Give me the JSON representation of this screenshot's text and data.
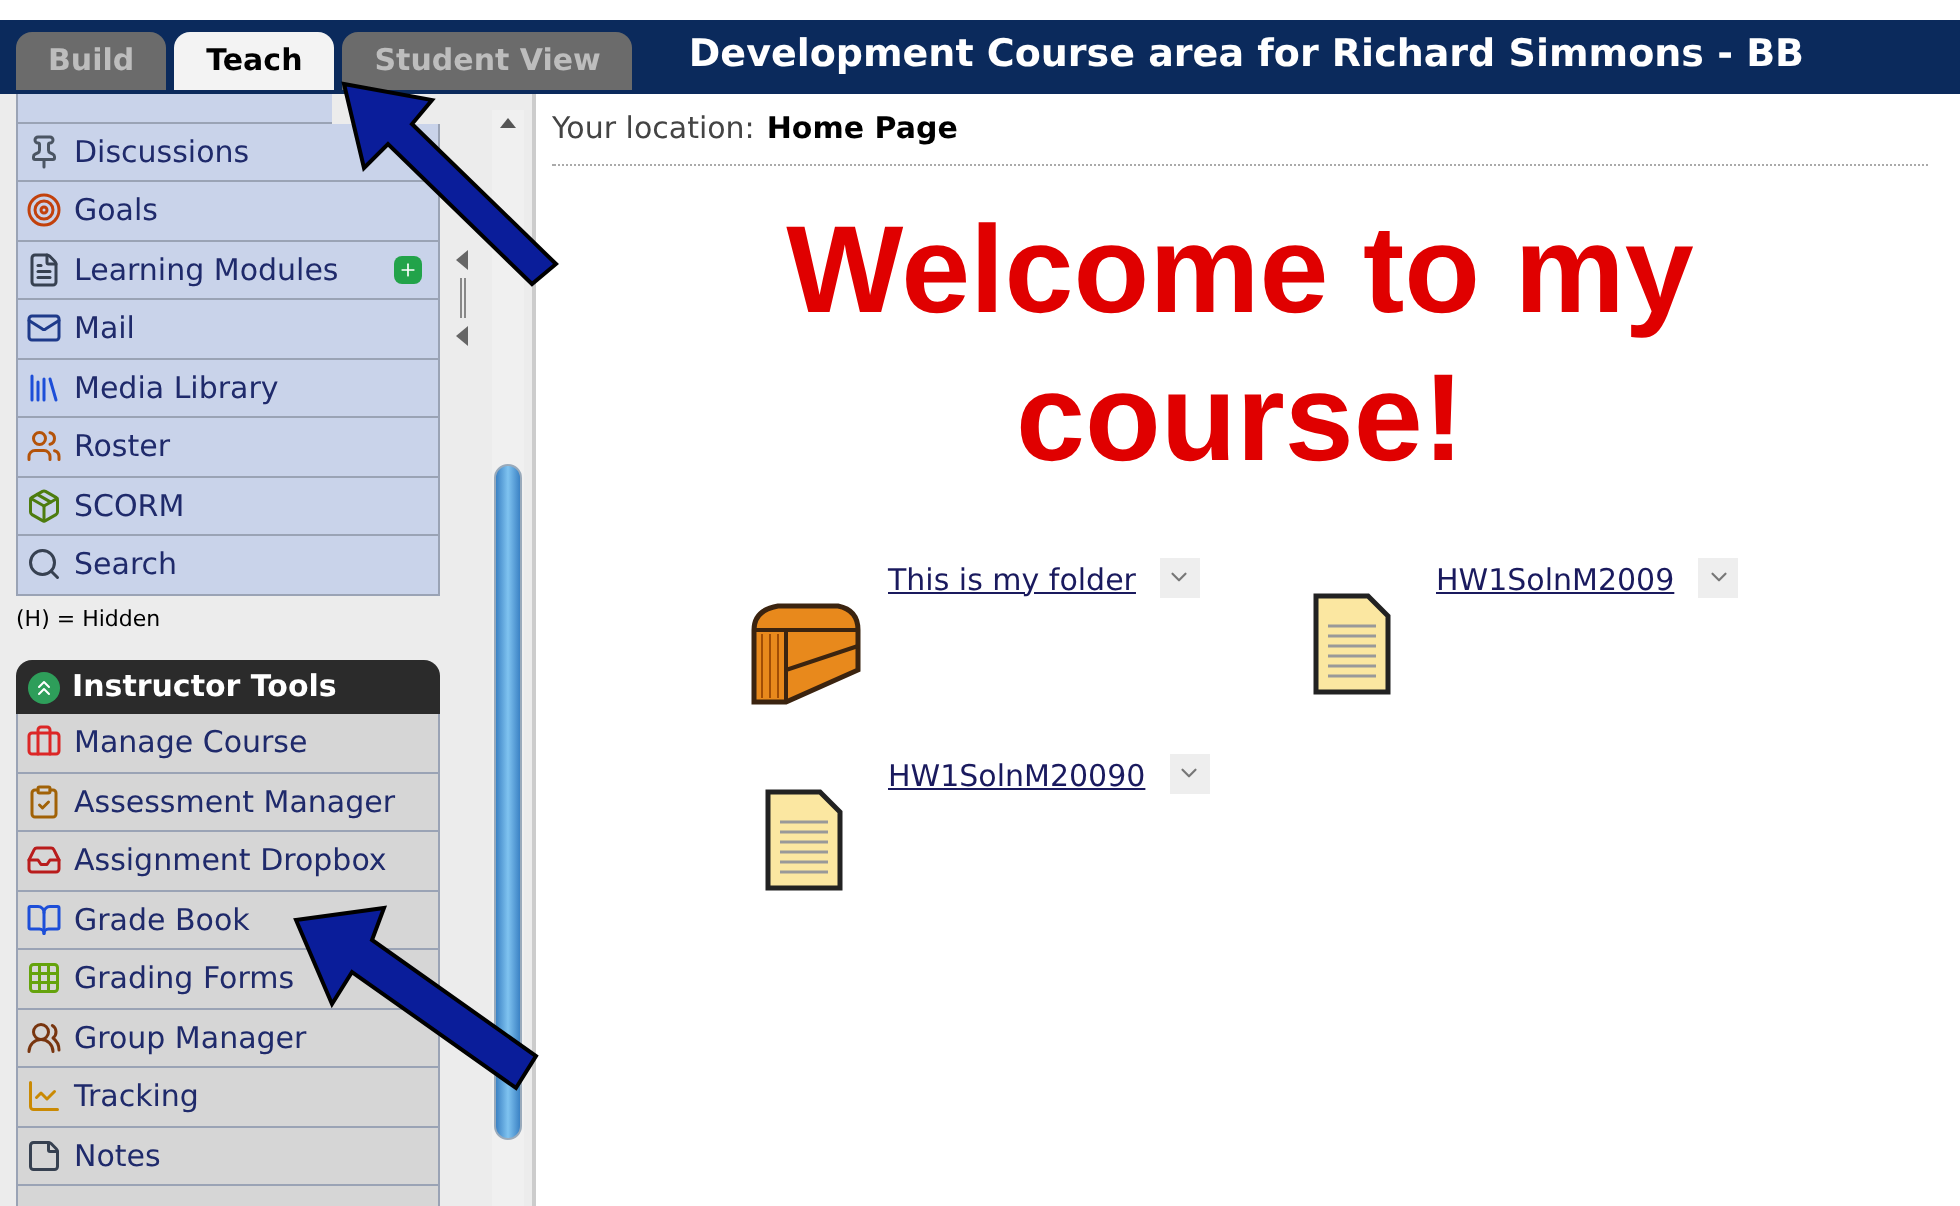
{
  "tabs": [
    {
      "label": "Build",
      "selected": false
    },
    {
      "label": "Teach",
      "selected": true
    },
    {
      "label": "Student View",
      "selected": false
    }
  ],
  "course_title": "Development Course area for Richard Simmons - BB",
  "sidebar": {
    "items": [
      {
        "label": "Discussions",
        "flagged": false
      },
      {
        "label": "Goals",
        "flagged": false
      },
      {
        "label": "Learning Modules",
        "flagged": true
      },
      {
        "label": "Mail",
        "flagged": false
      },
      {
        "label": "Media Library",
        "flagged": false
      },
      {
        "label": "Roster",
        "flagged": false
      },
      {
        "label": "SCORM",
        "flagged": false
      },
      {
        "label": "Search",
        "flagged": false
      }
    ],
    "legend": "(H) = Hidden",
    "instructor_tools": {
      "title": "Instructor Tools",
      "expanded": true,
      "items": [
        {
          "label": "Manage Course"
        },
        {
          "label": "Assessment Manager"
        },
        {
          "label": "Assignment Dropbox"
        },
        {
          "label": "Grade Book"
        },
        {
          "label": "Grading Forms"
        },
        {
          "label": "Group Manager"
        },
        {
          "label": "Tracking"
        },
        {
          "label": "Notes"
        }
      ]
    }
  },
  "breadcrumb": {
    "label": "Your location:",
    "value": "Home Page"
  },
  "heading": "Welcome to my course!",
  "content_items": [
    {
      "kind": "folder",
      "label": "This is my folder"
    },
    {
      "kind": "file",
      "label": "HW1SolnM2009"
    },
    {
      "kind": "file",
      "label": "HW1SolnM20090"
    }
  ]
}
